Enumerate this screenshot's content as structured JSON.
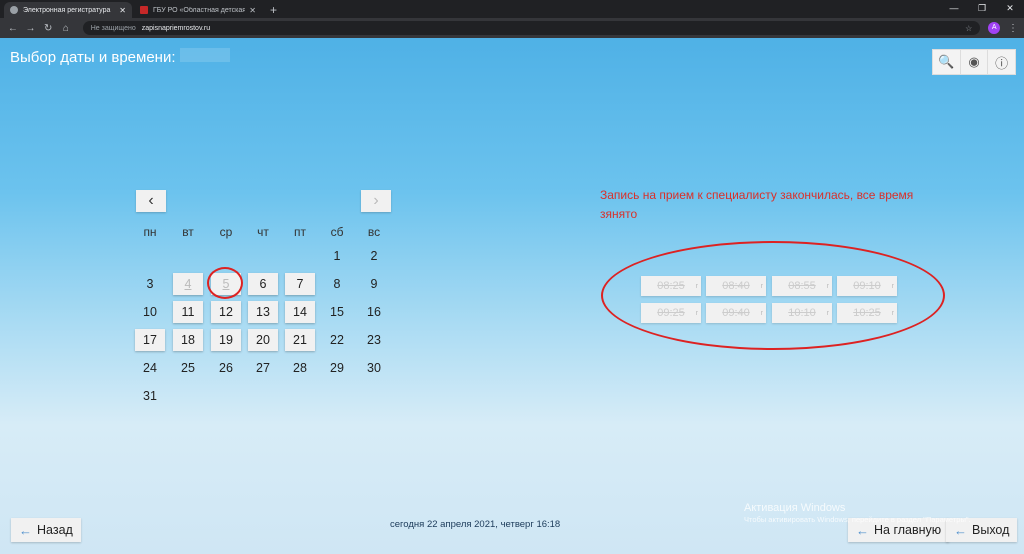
{
  "browser": {
    "tabs": [
      {
        "label": "Электронная регистратура",
        "active": true
      },
      {
        "label": "ГБУ РО «Областная детская кл...",
        "active": false
      }
    ],
    "new_tab": "+",
    "security": "Не защищено",
    "url": "zapisnapriemrostov.ru",
    "profile_initial": "A"
  },
  "header": {
    "title": "Выбор даты и времени:"
  },
  "calendar": {
    "weekdays": [
      "пн",
      "вт",
      "ср",
      "чт",
      "пт",
      "сб",
      "вс"
    ],
    "days": [
      "1",
      "2",
      "3",
      "4",
      "5",
      "6",
      "7",
      "8",
      "9",
      "10",
      "11",
      "12",
      "13",
      "14",
      "15",
      "16",
      "17",
      "18",
      "19",
      "20",
      "21",
      "22",
      "23",
      "24",
      "25",
      "26",
      "27",
      "28",
      "29",
      "30",
      "31"
    ],
    "disabled_days": [
      "4",
      "5"
    ],
    "active_days": [
      "6",
      "7",
      "11",
      "12",
      "13",
      "14",
      "17",
      "18",
      "19",
      "20",
      "21"
    ]
  },
  "notice": "Запись на прием к специалисту закончилась, все время зянято",
  "time_slots": [
    "08:25",
    "08:40",
    "08:55",
    "09:10",
    "09:25",
    "09:40",
    "10:10",
    "10:25"
  ],
  "footer": {
    "back_label": "Назад",
    "home_label": "На главную",
    "exit_label": "Выход",
    "date_text": "сегодня 22 апреля 2021, четверг 16:18"
  },
  "watermark": {
    "line1": "Активация Windows",
    "line2": "Чтобы активировать Windows, перейдите в раздел \"Параметры\"."
  },
  "colors": {
    "notice": "#d9302a",
    "accent_arrow": "#4d8fcc"
  }
}
